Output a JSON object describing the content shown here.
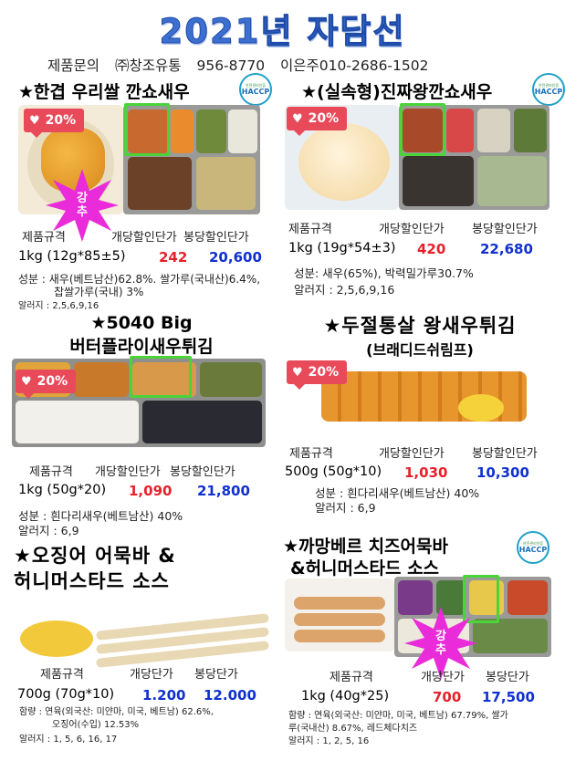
{
  "header": {
    "title": "2021년 자담선",
    "contact_label": "제품문의",
    "company": "㈜창조유통",
    "phone": "956-8770",
    "contact_person": "이은주010-2686-1502"
  },
  "colors": {
    "title_blue": "#3d6fd0",
    "price_red": "#e8202a",
    "price_blue": "#1030d0",
    "badge_red": "#e84a5a",
    "highlight_green": "#4ad43a",
    "burst_magenta": "#e92bd9"
  },
  "icons": [
    "heart-icon",
    "haccp-badge-icon",
    "star-burst-icon"
  ],
  "products": [
    {
      "title": "★한겹 우리쌀 깐쇼새우",
      "badge": "20%",
      "burst": "강추",
      "has_haccp": true,
      "labels": [
        "제품규격",
        "개당할인단가",
        "봉당할인단가"
      ],
      "spec": "1kg (12g*85±5)",
      "unit_price": "242",
      "pack_price": "20,600",
      "ingredients_1": "성분 : 새우(베트남산)62.8%. 쌀가루(국내산)6.4%,",
      "ingredients_2": "찹쌀가루(국내) 3%",
      "allergens": "알러지 : 2,5,6,9,16"
    },
    {
      "title": "★(실속형)진짜왕깐쇼새우",
      "badge": "20%",
      "has_haccp": true,
      "labels": [
        "제품규격",
        "개당할인단가",
        "봉당할인단가"
      ],
      "spec": "1kg (19g*54±3)",
      "unit_price": "420",
      "pack_price": "22,680",
      "ingredients_1": "성분: 새우(65%), 박력밀가루30.7%",
      "allergens": "알러지 : 2,5,6,9,16"
    },
    {
      "title_1": "★5040 Big",
      "title_2": "버터플라이새우튀김",
      "badge": "20%",
      "labels": [
        "제품규격",
        "개당할인단가",
        "봉당할인단가"
      ],
      "spec": "1kg (50g*20)",
      "unit_price": "1,090",
      "pack_price": "21,800",
      "ingredients_1": "성분 : 흰다리새우(베트남산) 40%",
      "allergens": "알러지 : 6,9"
    },
    {
      "title_1": "★두절통살 왕새우튀김",
      "title_2": "(브래디드쉬림프)",
      "badge": "20%",
      "labels": [
        "제품규격",
        "개당할인단가",
        "봉당할인단가"
      ],
      "spec": "500g (50g*10)",
      "unit_price": "1,030",
      "pack_price": "10,300",
      "ingredients_1": "성분 : 흰다리새우(베트남산) 40%",
      "allergens": "알러지 : 6,9"
    },
    {
      "title_1": "★오징어 어묵바 &",
      "title_2": "허니머스타드 소스",
      "labels": [
        "제품규격",
        "개당단가",
        "봉당단가"
      ],
      "spec": "700g (70g*10)",
      "unit_price": "1.200",
      "pack_price": "12.000",
      "ingredients_1": "함량 : 연육(외국산: 미얀마, 미국, 베트남) 62.6%,",
      "ingredients_2": "오징어(수입) 12.53%",
      "allergens": "알러지 : 1, 5, 6, 16, 17"
    },
    {
      "title_1": "★까망베르 치즈어묵바",
      "title_2": "&허니머스타드 소스",
      "burst": "강추",
      "has_haccp": true,
      "labels": [
        "제품규격",
        "개당단가",
        "봉당단가"
      ],
      "spec": "1kg (40g*25)",
      "unit_price": "700",
      "pack_price": "17,500",
      "ingredients_1": "함량 : 연육(외국산: 미얀마, 미국, 베트남) 67.79%, 쌀가",
      "ingredients_2": "루(국내산) 8.67%, 레드체다치즈",
      "allergens": "알러지 : 1, 2, 5, 16"
    }
  ],
  "haccp_text": {
    "top": "안전관리인증",
    "main": "HACCP"
  }
}
